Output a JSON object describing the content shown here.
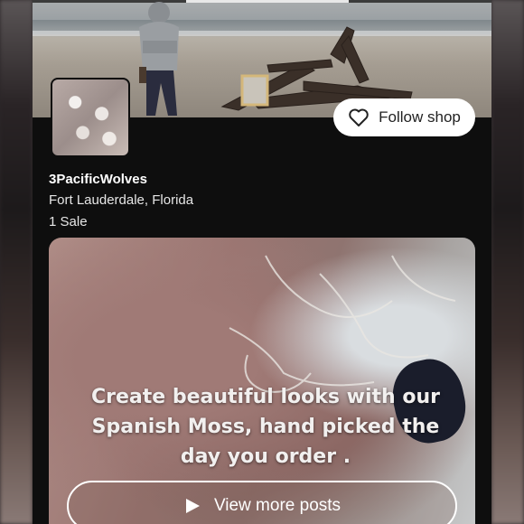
{
  "shop": {
    "name": "3PacificWolves",
    "location": "Fort Lauderdale, Florida",
    "sales": "1 Sale"
  },
  "follow_button": {
    "label": "Follow shop",
    "icon": "heart-outline-icon"
  },
  "post": {
    "caption": "Create beautiful looks with our Spanish Moss, hand picked the day you order ."
  },
  "view_more_button": {
    "label": "View more posts",
    "icon": "play-icon"
  },
  "colors": {
    "background": "#0e0e0e",
    "button_bg": "#ffffff",
    "text": "#ffffff"
  }
}
